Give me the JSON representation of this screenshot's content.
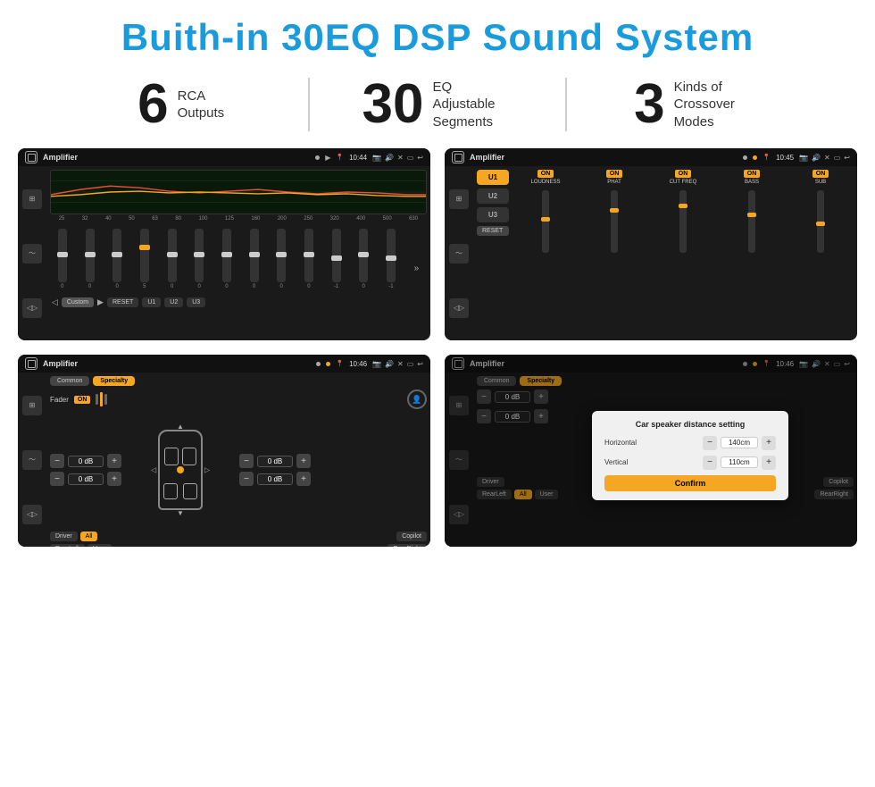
{
  "header": {
    "title": "Buith-in 30EQ DSP Sound System"
  },
  "stats": [
    {
      "number": "6",
      "label": "RCA\nOutputs"
    },
    {
      "number": "30",
      "label": "EQ Adjustable\nSegments"
    },
    {
      "number": "3",
      "label": "Kinds of\nCrossover Modes"
    }
  ],
  "screens": {
    "eq": {
      "title": "Amplifier",
      "time": "10:44",
      "freq_labels": [
        "25",
        "32",
        "40",
        "50",
        "63",
        "80",
        "100",
        "125",
        "160",
        "200",
        "250",
        "320",
        "400",
        "500",
        "630"
      ],
      "slider_values": [
        "0",
        "0",
        "0",
        "5",
        "0",
        "0",
        "0",
        "0",
        "0",
        "0",
        "-1",
        "0",
        "-1"
      ],
      "buttons": [
        "Custom",
        "RESET",
        "U1",
        "U2",
        "U3"
      ]
    },
    "crossover": {
      "title": "Amplifier",
      "time": "10:45",
      "channels": [
        "U1",
        "U2",
        "U3"
      ],
      "controls": [
        "LOUDNESS",
        "PHAT",
        "CUT FREQ",
        "BASS",
        "SUB"
      ]
    },
    "fader": {
      "title": "Amplifier",
      "time": "10:46",
      "tabs": [
        "Common",
        "Specialty"
      ],
      "fader_label": "Fader",
      "fader_on": "ON",
      "volumes": [
        "0 dB",
        "0 dB",
        "0 dB",
        "0 dB"
      ],
      "zone_buttons": [
        "Driver",
        "All",
        "Copilot",
        "RearLeft",
        "User",
        "RearRight"
      ]
    },
    "distance": {
      "title": "Amplifier",
      "time": "10:46",
      "dialog_title": "Car speaker distance setting",
      "horizontal_label": "Horizontal",
      "horizontal_value": "140cm",
      "vertical_label": "Vertical",
      "vertical_value": "110cm",
      "confirm_label": "Confirm",
      "tabs": [
        "Common",
        "Specialty"
      ],
      "zone_buttons": [
        "Driver",
        "Copilot",
        "RearLeft",
        "User",
        "RearRight"
      ],
      "volumes": [
        "0 dB",
        "0 dB"
      ]
    }
  },
  "colors": {
    "accent": "#f5a623",
    "blue": "#1a9bdc",
    "dark_bg": "#1a1a1a",
    "screen_bg": "#111"
  }
}
